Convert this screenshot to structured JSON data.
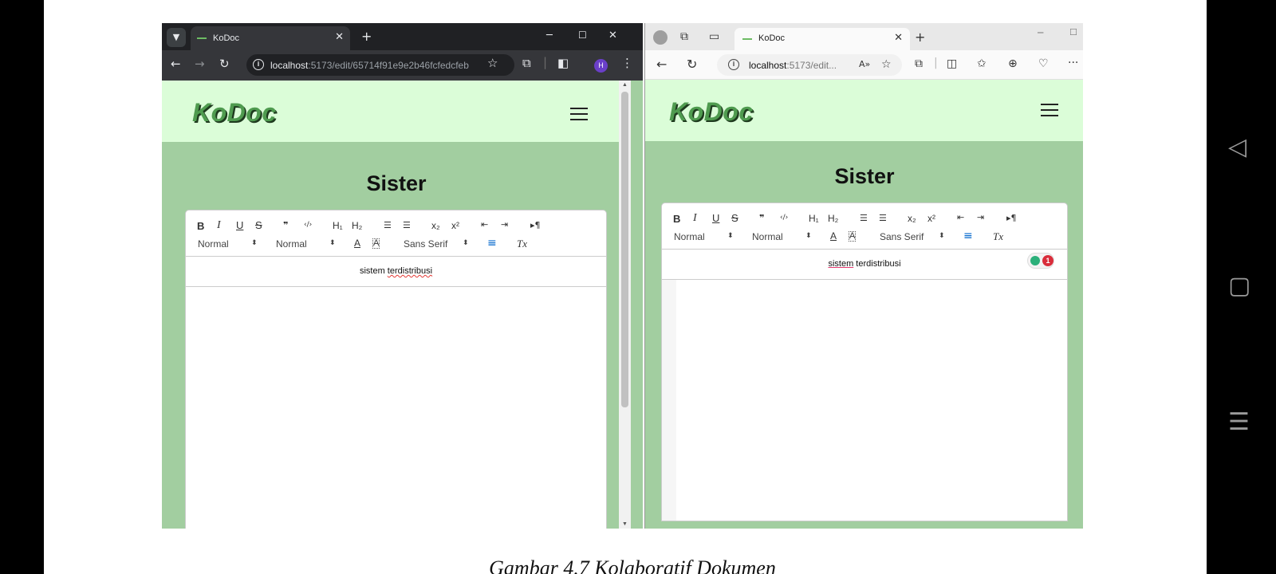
{
  "caption": "Gambar 4.7 Kolaboratif Dokumen",
  "colors": {
    "header_bg": "#dbfdd8",
    "page_bg": "#a2cea0",
    "logo": "#4f9b4f"
  },
  "chrome": {
    "tab_title": "KoDoc",
    "tab_close": "✕",
    "new_tab": "+",
    "url_host": "localhost",
    "url_path": ":5173/edit/65714f91e9e2b46fcfedcfeb",
    "avatar_letter": "H"
  },
  "edge": {
    "tab_title": "KoDoc",
    "tab_close": "✕",
    "new_tab": "+",
    "url_host": "localhost",
    "url_path": ":5173/edit...",
    "more": "···"
  },
  "app": {
    "logo": "KoDoc",
    "doc_title": "Sister",
    "toolbar": {
      "bold": "B",
      "italic": "I",
      "underline": "U",
      "strike": "S",
      "blockquote": "❞",
      "code": "‹/›",
      "h1": "H₁",
      "h2": "H₂",
      "ordered_list": "☰",
      "bullet_list": "☰",
      "subscript": "x₂",
      "superscript": "x²",
      "outdent": "⇤",
      "indent": "⇥",
      "direction": "▸¶",
      "size_select": "Normal",
      "header_select": "Normal",
      "color": "A",
      "background": "A",
      "font_select": "Sans Serif",
      "align": "≡",
      "clean": "Tx"
    },
    "line_words": [
      "sistem",
      "terdistribusi"
    ],
    "grammar_count": "1"
  }
}
